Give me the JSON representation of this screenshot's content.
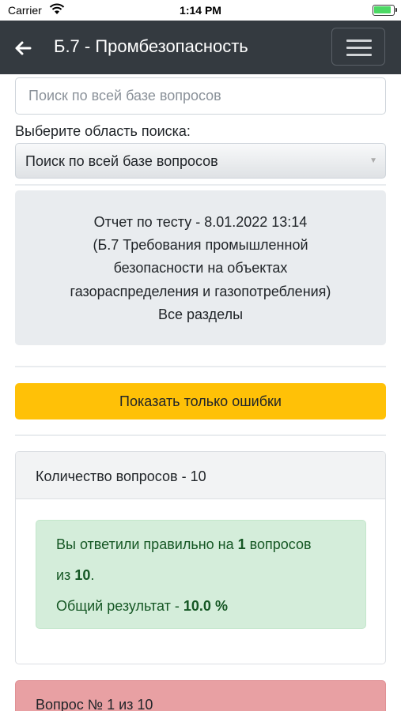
{
  "status_bar": {
    "carrier": "Carrier",
    "time": "1:14 PM",
    "battery_level": 0.9
  },
  "navbar": {
    "title": "Б.7 - Промбезопасность",
    "back_icon": "arrow-left-icon",
    "menu_icon": "hamburger-menu-icon"
  },
  "search": {
    "placeholder": "Поиск по всей базе вопросов",
    "scope_label": "Выберите область поиска:",
    "scope_value": "Поиск по всей базе вопросов"
  },
  "report": {
    "line1": "Отчет по тесту - 8.01.2022 13:14",
    "line2": "(Б.7 Требования промышленной",
    "line3": "безопасности на объектах",
    "line4": "газораспределения и газопотребления)",
    "line5": "Все разделы"
  },
  "errors_button": {
    "label": "Показать только ошибки"
  },
  "results": {
    "header": "Количество вопросов - 10",
    "answered_prefix": "Вы ответили правильно на",
    "correct": "1",
    "answered_suffix": "вопросов",
    "of_prefix": "из",
    "total": "10",
    "of_suffix": ".",
    "overall_prefix": "Общий результат -",
    "overall_value": "10.0 %"
  },
  "question": {
    "title": "Вопрос № 1 из 10"
  },
  "colors": {
    "navbar": "#343a40",
    "warning": "#ffc107",
    "success_bg": "#d4edda",
    "success_text": "#155724",
    "danger_bg": "#e8a0a3"
  }
}
